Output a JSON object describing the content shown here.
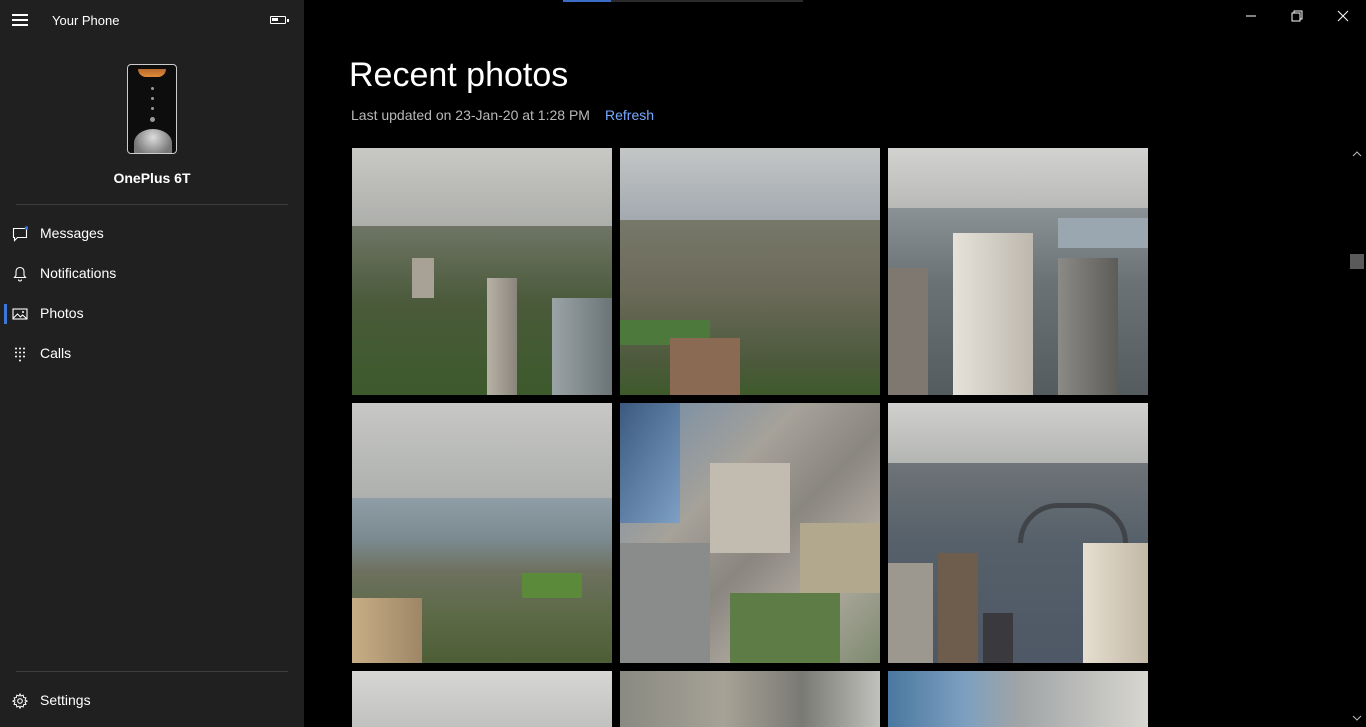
{
  "app": {
    "title": "Your Phone"
  },
  "device": {
    "name": "OnePlus 6T"
  },
  "nav": {
    "items": [
      {
        "label": "Messages",
        "icon": "message-icon"
      },
      {
        "label": "Notifications",
        "icon": "bell-icon"
      },
      {
        "label": "Photos",
        "icon": "photos-icon",
        "active": true
      },
      {
        "label": "Calls",
        "icon": "dialpad-icon"
      }
    ],
    "settings": {
      "label": "Settings",
      "icon": "gear-icon"
    }
  },
  "main": {
    "title": "Recent photos",
    "last_updated": "Last updated on 23-Jan-20 at 1:28 PM",
    "refresh_label": "Refresh"
  },
  "colors": {
    "sidebar_bg": "#202020",
    "main_bg": "#000000",
    "accent": "#3b78d8",
    "link": "#78a9ff"
  },
  "photos": [
    {
      "name": "photo-1",
      "description": "Sydney city skyline with park, overcast sky"
    },
    {
      "name": "photo-2",
      "description": "Sydney suburbs with cathedral and park"
    },
    {
      "name": "photo-3",
      "description": "Sydney CBD towers near harbour"
    },
    {
      "name": "photo-4",
      "description": "Sydney harbour with Darling Harbour and parkland"
    },
    {
      "name": "photo-5",
      "description": "Looking straight down at city streets and buildings"
    },
    {
      "name": "photo-6",
      "description": "Sydney Harbour Bridge with skyline"
    },
    {
      "name": "photo-7",
      "description": "Overcast sky over city"
    },
    {
      "name": "photo-8",
      "description": "Rooftops of buildings from above"
    },
    {
      "name": "photo-9",
      "description": "Glass tower and rooftops from above"
    }
  ]
}
